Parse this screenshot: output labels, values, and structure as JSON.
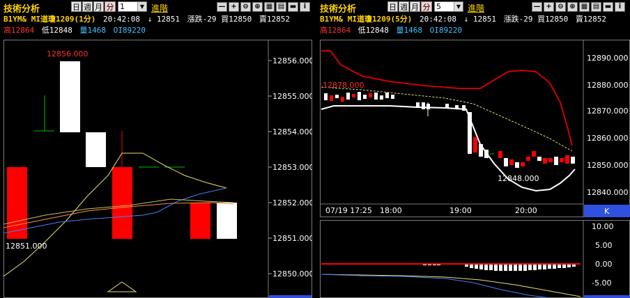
{
  "left": {
    "title": "技術分析",
    "periods": [
      "日",
      "週",
      "月",
      "分"
    ],
    "active_period": "分",
    "interval_value": "1",
    "advanced_link": "進階",
    "info_line1": {
      "symbol": "B1YM&",
      "name": "MI道瓊1209(1分)",
      "time": "20:42:08",
      "arrow": "↓",
      "price": "12851",
      "change": "漲跌-29",
      "bid": "買12850",
      "ask": "賣12852"
    },
    "info_line2": {
      "high": "高12864",
      "low": "低12848",
      "volume": "量1468",
      "oi": "OI89220"
    },
    "axis_ticks": [
      "12856.000",
      "12855.000",
      "12854.000",
      "12853.000",
      "12852.000",
      "12851.000",
      "12850.000"
    ],
    "label_high": "12856.000",
    "label_low": "12851.000"
  },
  "right": {
    "title": "技術分析",
    "periods": [
      "日",
      "週",
      "月",
      "分"
    ],
    "active_period": "分",
    "interval_value": "5",
    "advanced_link": "進階",
    "info_line1": {
      "symbol": "B1YM&",
      "name": "MI道瓊1209(5分)",
      "time": "20:42:08",
      "arrow": "↓",
      "price": "12851",
      "change": "漲跌-29",
      "bid": "買12850",
      "ask": "賣12852"
    },
    "info_line2": {
      "high": "高12864",
      "low": "低12848",
      "volume": "量1468",
      "oi": "OI89220"
    },
    "axis_ticks": [
      "12890.000",
      "12880.000",
      "12870.000",
      "12860.000",
      "12850.000",
      "12840.000"
    ],
    "label_high": "12878.000",
    "label_low": "12848.000",
    "time_labels": [
      "07/19 17:25",
      "18:00",
      "19:00",
      "20:00"
    ],
    "k_button": "K",
    "sub_ticks": [
      "10.00",
      "5.00",
      "0.00",
      "-5.00"
    ]
  },
  "icons": [
    "zoom-out-icon",
    "zoom-in-icon",
    "search-minus-icon",
    "search-plus-icon",
    "table-icon",
    "print-icon",
    "window-icon",
    "info-icon"
  ],
  "colors": {
    "up": "#ff0000",
    "down": "#ffffff",
    "title": "#ffd200",
    "high": "#ff3030",
    "low": "#ffffff",
    "volume": "#40c0ff",
    "oi": "#40c0ff",
    "band": "#d00000"
  }
}
